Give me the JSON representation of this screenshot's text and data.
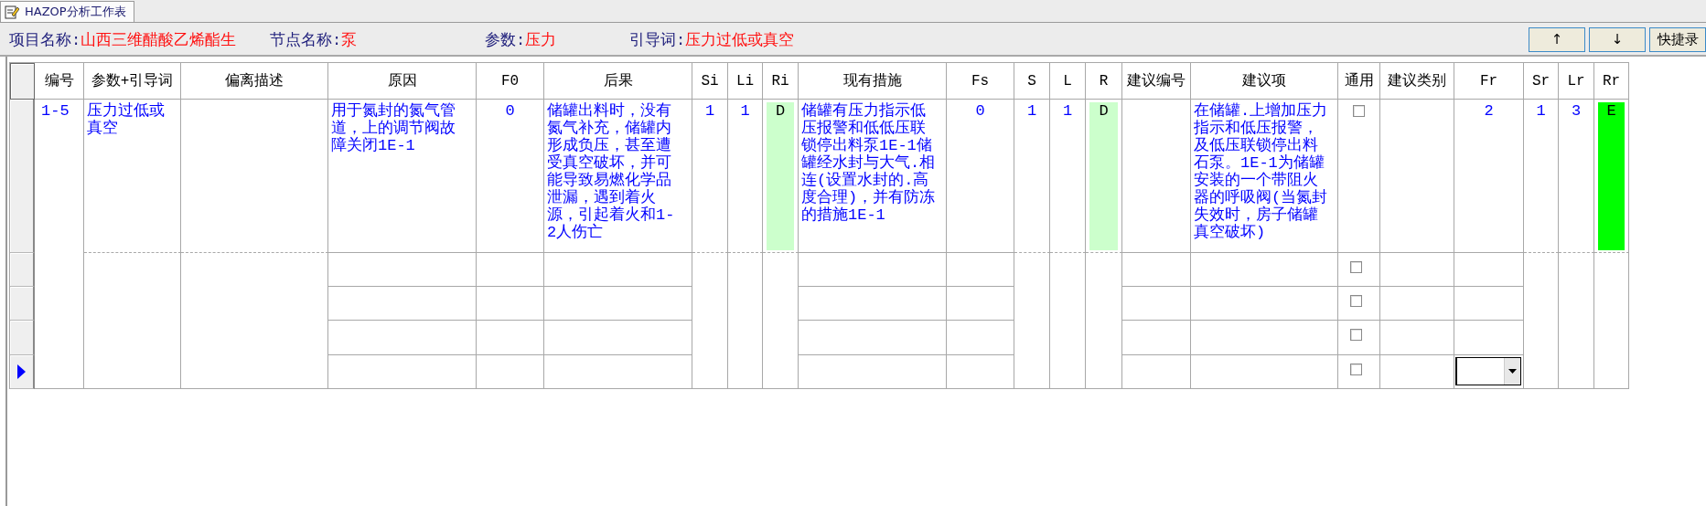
{
  "tab": {
    "label": "HAZOP分析工作表",
    "selected": true
  },
  "info": [
    {
      "label": "项目名称:",
      "value": "山西三维醋酸乙烯酯生"
    },
    {
      "label": "节点名称:",
      "value": "泵"
    },
    {
      "label": "参数:",
      "value": "压力"
    },
    {
      "label": "引导词:",
      "value": "压力过低或真空"
    }
  ],
  "buttons": [
    "↑",
    "↓",
    "快捷录"
  ],
  "table": {
    "columns": [
      {
        "label": "编号",
        "kind": "whole"
      },
      {
        "label": "参数+引导词",
        "kind": "merged"
      },
      {
        "label": "偏离描述",
        "kind": "merged"
      },
      {
        "label": "原因",
        "kind": "split"
      },
      {
        "label": "F0",
        "kind": "split"
      },
      {
        "label": "后果",
        "kind": "split"
      },
      {
        "label": "Si",
        "kind": "merged"
      },
      {
        "label": "Li",
        "kind": "merged"
      },
      {
        "label": "Ri",
        "kind": "merged"
      },
      {
        "label": "现有措施",
        "kind": "split"
      },
      {
        "label": "Fs",
        "kind": "split"
      },
      {
        "label": "S",
        "kind": "merged"
      },
      {
        "label": "L",
        "kind": "merged"
      },
      {
        "label": "R",
        "kind": "merged"
      },
      {
        "label": "建议编号",
        "kind": "split"
      },
      {
        "label": "建议项",
        "kind": "split"
      },
      {
        "label": "通用",
        "kind": "split"
      },
      {
        "label": "建议类别",
        "kind": "split"
      },
      {
        "label": "Fr",
        "kind": "split"
      },
      {
        "label": "Sr",
        "kind": "merged"
      },
      {
        "label": "Lr",
        "kind": "merged"
      },
      {
        "label": "Rr",
        "kind": "merged"
      }
    ],
    "rows": [
      {
        "selected": false,
        "cells": [
          {
            "kind": "text",
            "text": "1-5"
          },
          {
            "kind": "text",
            "text": "压力过低或真空"
          },
          {
            "kind": "blank"
          },
          {
            "kind": "text",
            "text": "用于氮封的氮气管道，上的调节阀故障关闭1E-1"
          },
          {
            "kind": "number",
            "text": "0"
          },
          {
            "kind": "text",
            "text": "储罐出料时，没有氮气补充，储罐内形成负压，甚至遭受真空破坏，并可能导致易燃化学品泄漏，遇到着火源，引起着火和1-2人伤亡"
          },
          {
            "kind": "number",
            "text": "1"
          },
          {
            "kind": "number",
            "text": "1"
          },
          {
            "kind": "risk",
            "text": "D",
            "color": "#ccffcc"
          },
          {
            "kind": "text",
            "text": "储罐有压力指示低压报警和低低压联锁停出料泵1E-1储罐经水封与大气.相连(设置水封的.高度合理)，并有防冻的措施1E-1"
          },
          {
            "kind": "number",
            "text": "0"
          },
          {
            "kind": "number",
            "text": "1"
          },
          {
            "kind": "number",
            "text": "1"
          },
          {
            "kind": "risk",
            "text": "D",
            "color": "#ccffcc"
          },
          {
            "kind": "blank"
          },
          {
            "kind": "text",
            "text": "在储罐.上增加压力指示和低压报警，及低压联锁停出料石泵。1E-1为储罐安装的一个带阻火器的呼吸阀(当氮封失效时，房子储罐真空破坏)"
          },
          {
            "kind": "checkbox",
            "checked": false
          },
          {
            "kind": "blank"
          },
          {
            "kind": "number",
            "text": "2"
          },
          {
            "kind": "number",
            "text": "1"
          },
          {
            "kind": "number",
            "text": "3"
          },
          {
            "kind": "risk",
            "text": "E",
            "color": "#00ff00"
          }
        ]
      },
      {
        "selected": false,
        "cells": [
          {
            "kind": "blank"
          },
          {
            "kind": "blank"
          },
          {
            "kind": "blank"
          },
          {
            "kind": "blank"
          },
          {
            "kind": "blank"
          },
          {
            "kind": "blank"
          },
          {
            "kind": "blank"
          },
          {
            "kind": "checkbox",
            "checked": false
          },
          {
            "kind": "blank"
          },
          {
            "kind": "blank"
          }
        ]
      },
      {
        "selected": false,
        "cells": [
          {
            "kind": "blank"
          },
          {
            "kind": "blank"
          },
          {
            "kind": "blank"
          },
          {
            "kind": "blank"
          },
          {
            "kind": "blank"
          },
          {
            "kind": "blank"
          },
          {
            "kind": "blank"
          },
          {
            "kind": "checkbox",
            "checked": false
          },
          {
            "kind": "blank"
          },
          {
            "kind": "blank"
          }
        ]
      },
      {
        "selected": false,
        "cells": [
          {
            "kind": "blank"
          },
          {
            "kind": "blank"
          },
          {
            "kind": "blank"
          },
          {
            "kind": "blank"
          },
          {
            "kind": "blank"
          },
          {
            "kind": "blank"
          },
          {
            "kind": "blank"
          },
          {
            "kind": "checkbox",
            "checked": false
          },
          {
            "kind": "blank"
          },
          {
            "kind": "blank"
          }
        ]
      },
      {
        "selected": true,
        "cells": [
          {
            "kind": "blank"
          },
          {
            "kind": "blank"
          },
          {
            "kind": "blank"
          },
          {
            "kind": "blank"
          },
          {
            "kind": "blank"
          },
          {
            "kind": "blank"
          },
          {
            "kind": "blank"
          },
          {
            "kind": "checkbox",
            "checked": false
          },
          {
            "kind": "blank"
          },
          {
            "kind": "dropdown"
          }
        ]
      }
    ]
  }
}
